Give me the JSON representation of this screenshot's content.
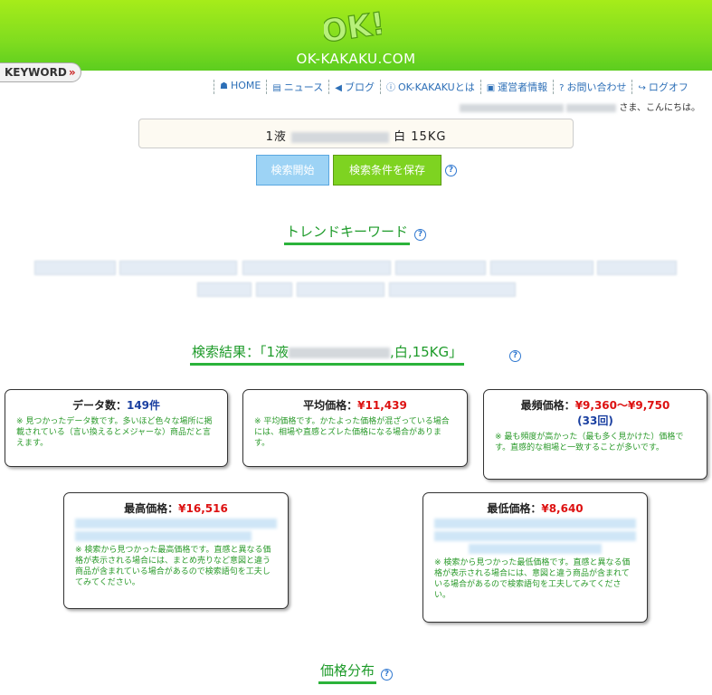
{
  "site": {
    "name": "OK-KAKAKU.COM",
    "logo_text": "OK!"
  },
  "keyword_tab": {
    "label": "KEYWORD",
    "arrow": "»"
  },
  "nav": [
    {
      "icon": "home-icon",
      "glyph": "☗",
      "label": "HOME"
    },
    {
      "icon": "news-icon",
      "glyph": "▤",
      "label": "ニュース"
    },
    {
      "icon": "megaphone-icon",
      "glyph": "◀",
      "label": "ブログ"
    },
    {
      "icon": "info-icon",
      "glyph": "ⓘ",
      "label": "OK-KAKAKUとは"
    },
    {
      "icon": "id-card-icon",
      "glyph": "▣",
      "label": "運営者情報"
    },
    {
      "icon": "question-icon",
      "glyph": "?",
      "label": "お問い合わせ"
    },
    {
      "icon": "logout-icon",
      "glyph": "↪",
      "label": "ログオフ"
    }
  ],
  "greeting": {
    "text": "さま、こんにちは。"
  },
  "search": {
    "prefix": "1液",
    "suffix": "白 15KG"
  },
  "buttons": {
    "search": "検索開始",
    "save": "検索条件を保存",
    "help": "?"
  },
  "trend": {
    "title": "トレンドキーワード"
  },
  "results": {
    "title_prefix": "検索結果：「1液",
    "title_suffix": ",白,15KG」"
  },
  "cards": {
    "count": {
      "label": "データ数：",
      "value": "149件",
      "note": "※ 見つかったデータ数です。多いほど色々な場所に掲載されている（言い換えるとメジャーな）商品だと言えます。"
    },
    "avg": {
      "label": "平均価格：",
      "value": "¥11,439",
      "note": "※ 平均価格です。かたよった価格が混ざっている場合には、相場や直感とズレた価格になる場合があります。"
    },
    "mode": {
      "label": "最頻価格：",
      "value": "¥9,360～¥9,750",
      "sub": "(33回)",
      "note": "※ 最も頻度が高かった（最も多く見かけた）価格です。直感的な相場と一致することが多いです。"
    },
    "max": {
      "label": "最高価格：",
      "value": "¥16,516",
      "note": "※ 検索から見つかった最高価格です。直感と異なる価格が表示される場合には、まとめ売りなど意図と違う商品が含まれている場合があるので検索語句を工夫してみてください。"
    },
    "min": {
      "label": "最低価格：",
      "value": "¥8,640",
      "note": "※ 検索から見つかった最低価格です。直感と異なる価格が表示される場合には、意図と違う商品が含まれている場合があるので検索語句を工夫してみてください。"
    }
  },
  "distribution": {
    "title": "価格分布"
  }
}
